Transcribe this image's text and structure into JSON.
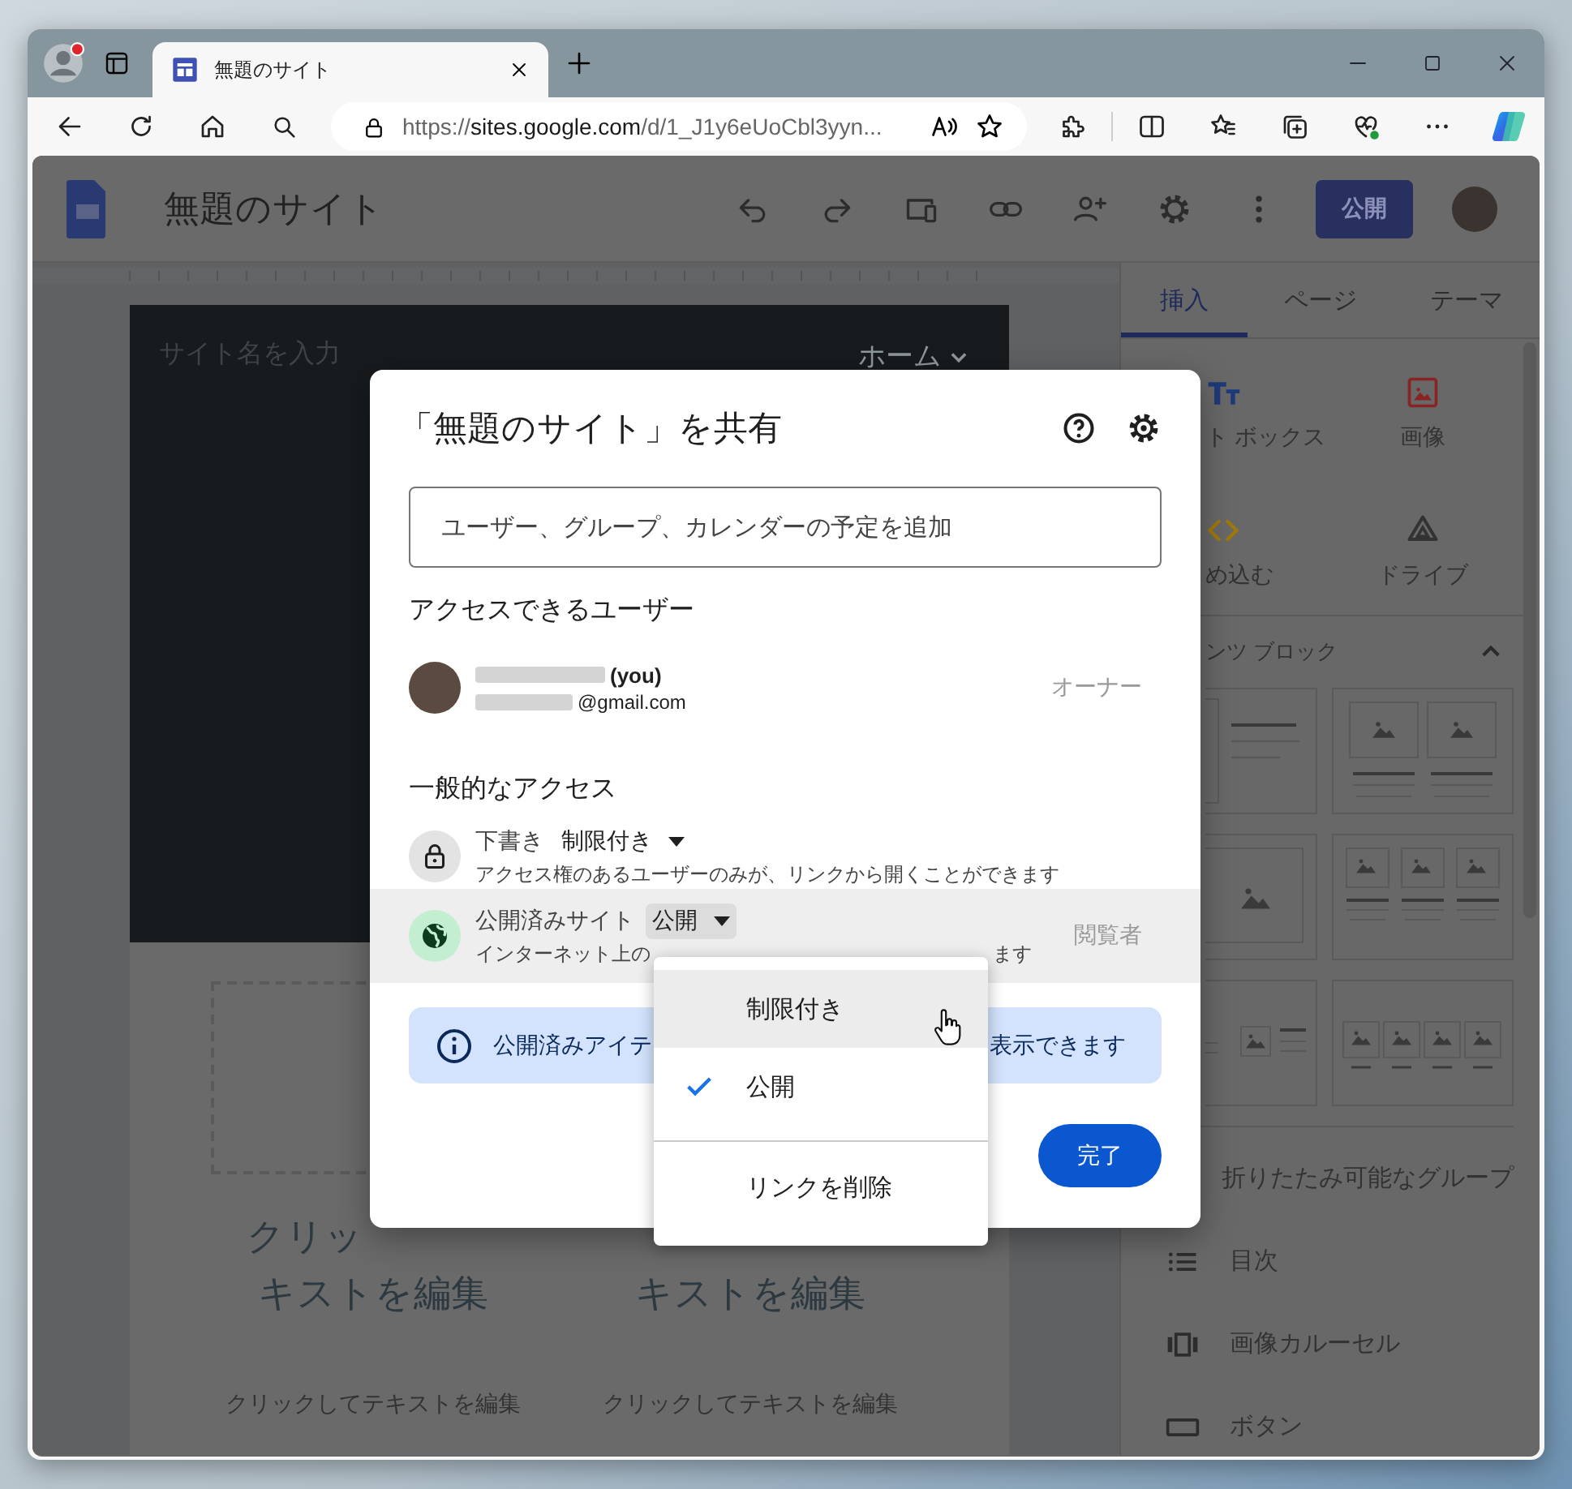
{
  "browser": {
    "tab": {
      "title": "無題のサイト",
      "selected": true
    },
    "url": {
      "scheme": "https://",
      "host": "sites.google.com",
      "path": "/d/1_J1y6eUoCbl3yyn..."
    }
  },
  "app": {
    "title": "無題のサイト",
    "publish_button": "公開"
  },
  "site_page": {
    "site_name_placeholder": "サイト名を入力",
    "nav_home": "ホーム",
    "text_blocks": [
      {
        "heading_top": "クリッ",
        "heading_bottom": "キストを編集",
        "body": "クリックしてテキストを編集"
      },
      {
        "heading_bottom": "キストを編集",
        "body": "クリックしてテキストを編集"
      }
    ]
  },
  "side_panel": {
    "tabs": [
      {
        "label": "挿入",
        "selected": true
      },
      {
        "label": "ページ",
        "selected": false
      },
      {
        "label": "テーマ",
        "selected": false
      }
    ],
    "insert_items": [
      {
        "kind": "textbox",
        "label": "ト ボックス"
      },
      {
        "kind": "image",
        "label": "画像"
      },
      {
        "kind": "embed",
        "label": "め込む"
      },
      {
        "kind": "drive",
        "label": "ドライブ"
      }
    ],
    "content_blocks": {
      "title": "ンツ ブロック",
      "expanded": true
    },
    "components": [
      {
        "kind": "group",
        "label": "折りたたみ可能なグループ"
      },
      {
        "kind": "toc",
        "label": "目次"
      },
      {
        "kind": "carousel",
        "label": "画像カルーセル"
      },
      {
        "kind": "button",
        "label": "ボタン"
      }
    ]
  },
  "dialog": {
    "title": "「無題のサイト」を共有",
    "add_people": {
      "placeholder": "ユーザー、グループ、カレンダーの予定を追加"
    },
    "people_heading": "アクセスできるユーザー",
    "people": [
      {
        "name_suffix": "(you)",
        "email_suffix": "@gmail.com",
        "role": "オーナー"
      }
    ],
    "general_heading": "一般的なアクセス",
    "access": [
      {
        "kind": "draft",
        "label": "下書き",
        "setting": "制限付き",
        "open": false,
        "highlighted": false,
        "description": [
          "アクセス権のあるユーザーのみが、リンクから開くことができます"
        ]
      },
      {
        "kind": "published",
        "label": "公開済みサイト",
        "setting": "公開",
        "open": true,
        "highlighted": true,
        "description": [
          "インターネット上の",
          "ます"
        ],
        "role": "閲覧者"
      }
    ],
    "info": [
      "公開済みアイテ",
      "表示できます"
    ],
    "done_button": "完了",
    "menu": {
      "options": [
        {
          "label": "制限付き",
          "selected": false,
          "hovered": true
        },
        {
          "label": "公開",
          "selected": true,
          "hovered": false
        }
      ],
      "actions": [
        {
          "label": "リンクを削除"
        }
      ]
    }
  }
}
